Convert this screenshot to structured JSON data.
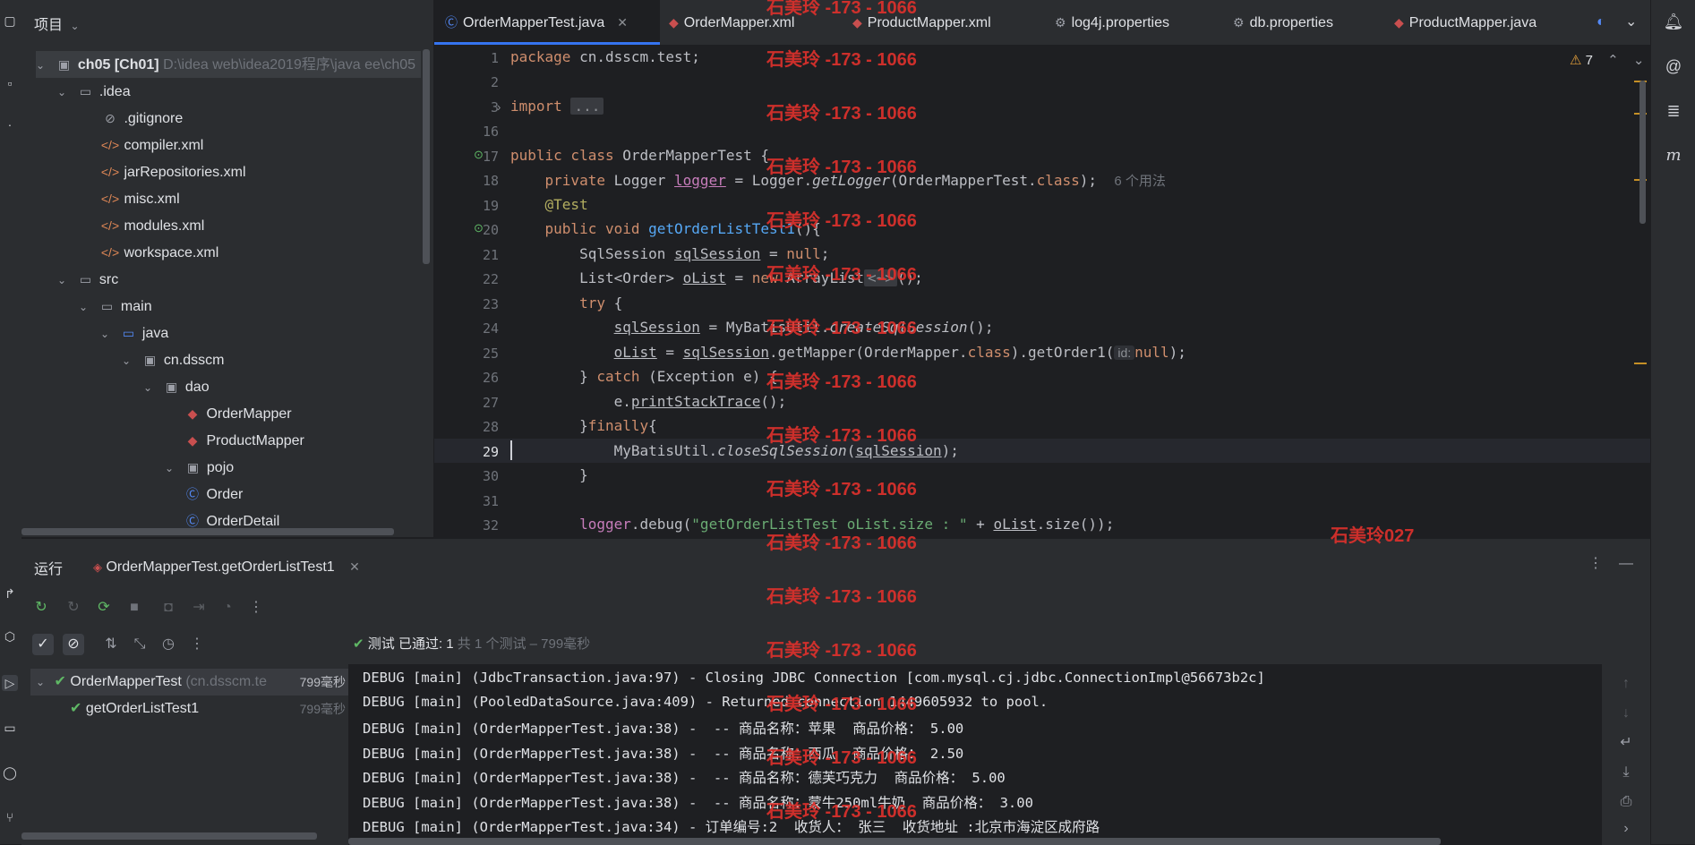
{
  "project": {
    "header": "项目",
    "tree": [
      {
        "label": "ch05",
        "module": "[Ch01]",
        "path": "D:\\idea web\\idea2019程序\\java ee\\ch05"
      },
      {
        "label": ".idea"
      },
      {
        "label": ".gitignore"
      },
      {
        "label": "compiler.xml"
      },
      {
        "label": "jarRepositories.xml"
      },
      {
        "label": "misc.xml"
      },
      {
        "label": "modules.xml"
      },
      {
        "label": "workspace.xml"
      },
      {
        "label": "src"
      },
      {
        "label": "main"
      },
      {
        "label": "java"
      },
      {
        "label": "cn.dsscm"
      },
      {
        "label": "dao"
      },
      {
        "label": "OrderMapper"
      },
      {
        "label": "ProductMapper"
      },
      {
        "label": "pojo"
      },
      {
        "label": "Order"
      },
      {
        "label": "OrderDetail"
      }
    ]
  },
  "tabs": [
    {
      "label": "OrderMapperTest.java",
      "active": true
    },
    {
      "label": "OrderMapper.xml"
    },
    {
      "label": "ProductMapper.xml"
    },
    {
      "label": "log4j.properties"
    },
    {
      "label": "db.properties"
    },
    {
      "label": "ProductMapper.java"
    }
  ],
  "editor": {
    "warning_count": "7",
    "line_numbers": [
      "1",
      "2",
      "3",
      "16",
      "17",
      "18",
      "19",
      "20",
      "21",
      "22",
      "23",
      "24",
      "25",
      "26",
      "27",
      "28",
      "29",
      "30",
      "31",
      "32"
    ],
    "code": {
      "l1_kw": "package",
      "l1_rest": " cn.dsscm.test;",
      "l3_kw": "import",
      "l3_fold": "...",
      "l17_kw": "public class",
      "l17_rest": " OrderMapperTest {",
      "l18_kw": "private",
      "l18_a": " Logger ",
      "l18_var": "logger",
      "l18_b": " = Logger.",
      "l18_fn": "getLogger",
      "l18_c": "(OrderMapperTest.",
      "l18_kw2": "class",
      "l18_d": ");",
      "l18_hint": "6 个用法",
      "l19": "@Test",
      "l20_kw": "public void",
      "l20_fn": " getOrderListTest1",
      "l20_rest": "(){",
      "l21_a": "SqlSession ",
      "l21_var": "sqlSession",
      "l21_b": " = ",
      "l21_kw": "null",
      "l21_c": ";",
      "l22_a": "List<Order> ",
      "l22_var": "oList",
      "l22_b": " = ",
      "l22_kw": "new",
      "l22_c": " ArrayList",
      "l22_fold": "<~>",
      "l22_d": "();",
      "l23_kw": "try",
      "l23_rest": " {",
      "l24_var": "sqlSession",
      "l24_a": " = MyBatisUtil.",
      "l24_fn": "createSqlSession",
      "l24_b": "();",
      "l25_var": "oList",
      "l25_a": " = ",
      "l25_var2": "sqlSession",
      "l25_b": ".getMapper(OrderMapper.",
      "l25_kw": "class",
      "l25_c": ").getOrder1(",
      "l25_hint": "id:",
      "l25_kw2": "null",
      "l25_d": ");",
      "l26_a": "} ",
      "l26_kw": "catch",
      "l26_b": " (Exception e) {",
      "l27_a": "e.",
      "l27_fn": "printStackTrace",
      "l27_b": "();",
      "l28_a": "}",
      "l28_kw": "finally",
      "l28_b": "{",
      "l29_a": "MyBatisUtil.",
      "l29_fn": "closeSqlSession",
      "l29_b": "(",
      "l29_var": "sqlSession",
      "l29_c": ");",
      "l30": "}",
      "l32_a": "logger",
      "l32_b": ".debug(",
      "l32_str": "\"getOrderListTest oList.size : \"",
      "l32_c": " + ",
      "l32_var": "oList",
      "l32_d": ".size());"
    }
  },
  "watermarks": {
    "repeat": "石美玲 -173 - 1066",
    "corner": "石美玲027"
  },
  "run": {
    "title": "运行",
    "config": "OrderMapperTest.getOrderListTest1",
    "status_label": "测试",
    "status_passed": "已通过: 1",
    "status_detail": "共 1 个测试 – 799毫秒",
    "tests": [
      {
        "name": "OrderMapperTest",
        "pkg": "(cn.dsscm.te",
        "time": "799毫秒"
      },
      {
        "name": "getOrderListTest1",
        "time": "799毫秒"
      }
    ],
    "console": [
      "DEBUG [main] (JdbcTransaction.java:97) - Closing JDBC Connection [com.mysql.cj.jdbc.ConnectionImpl@56673b2c]",
      "DEBUG [main] (PooledDataSource.java:409) - Returned connection 1449605932 to pool.",
      "DEBUG [main] (OrderMapperTest.java:38) -  -- 商品名称：苹果  商品价格： 5.00",
      "DEBUG [main] (OrderMapperTest.java:38) -  -- 商品名称：西瓜  商品价格： 2.50",
      "DEBUG [main] (OrderMapperTest.java:38) -  -- 商品名称：德芙巧克力  商品价格： 5.00",
      "DEBUG [main] (OrderMapperTest.java:38) -  -- 商品名称：蒙牛250ml牛奶  商品价格： 3.00",
      "DEBUG [main] (OrderMapperTest.java:34) - 订单编号:2  收货人： 张三  收货地址 :北京市海淀区成府路"
    ]
  }
}
